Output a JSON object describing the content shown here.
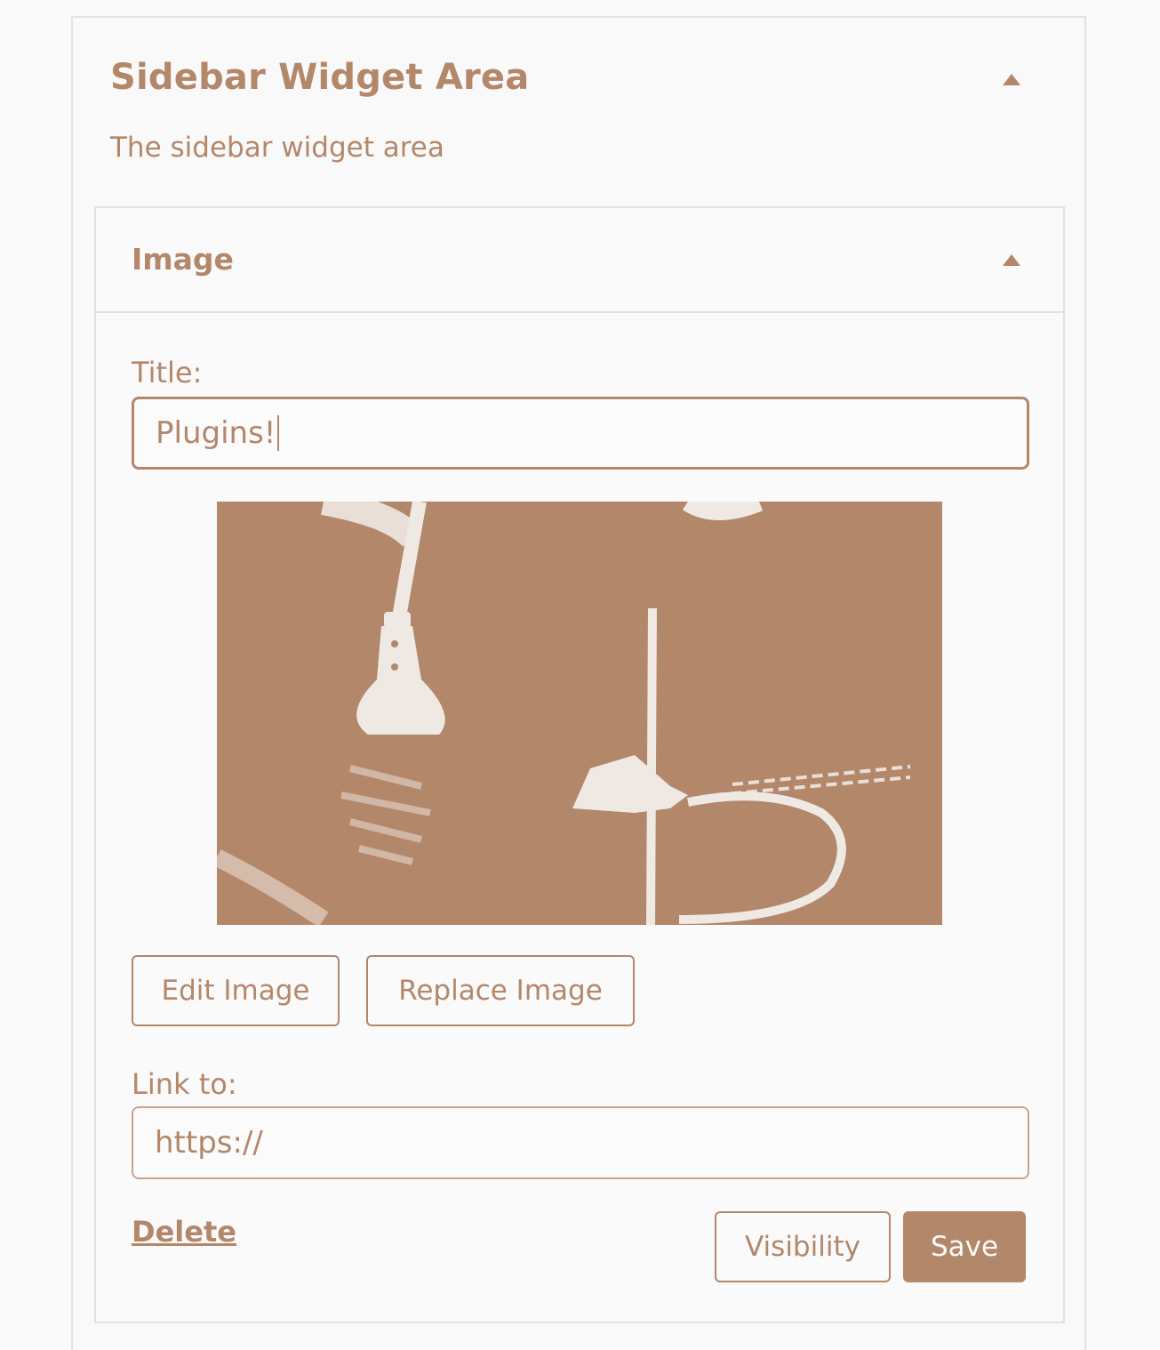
{
  "widget_area": {
    "title": "Sidebar Widget Area",
    "description": "The sidebar widget area"
  },
  "widget": {
    "title": "Image",
    "fields": {
      "title_label": "Title:",
      "title_value": "Plugins!",
      "link_label": "Link to:",
      "link_placeholder": "https://"
    },
    "image": {
      "alt": "Photo of two electrical plugs with cords"
    },
    "buttons": {
      "edit_image": "Edit Image",
      "replace_image": "Replace Image",
      "visibility": "Visibility",
      "save": "Save"
    },
    "delete_label": "Delete"
  },
  "colors": {
    "accent": "#b3876a",
    "background": "#fafafa",
    "border": "#e4dfdb"
  },
  "icons": {
    "area_toggle": "caret-up-icon",
    "widget_toggle": "caret-up-icon"
  }
}
